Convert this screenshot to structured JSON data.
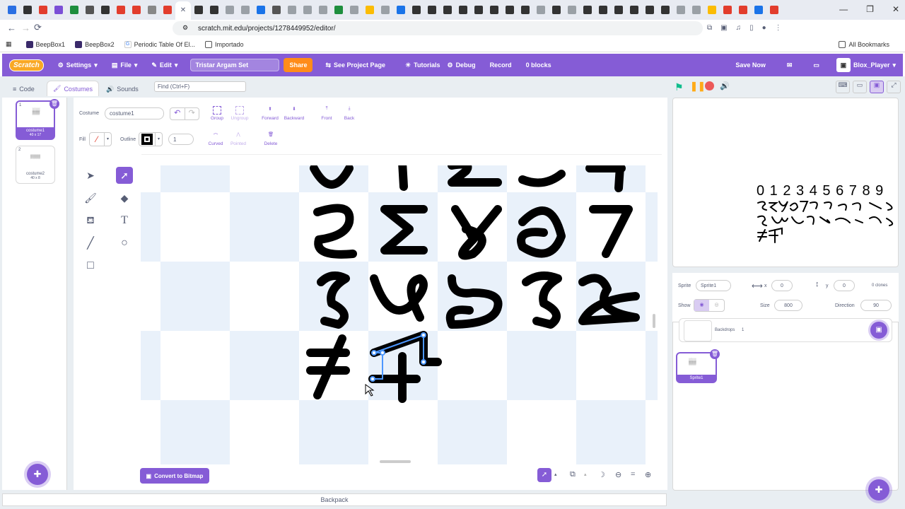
{
  "browser": {
    "url": "scratch.mit.edu/projects/1278449952/editor/",
    "bookmarks": [
      "BeepBox1",
      "BeepBox2",
      "Periodic Table Of El...",
      "Importado"
    ],
    "all_bookmarks_label": "All Bookmarks",
    "tab_colors": [
      "#2b6fe3",
      "#333",
      "#e23d2d",
      "#7b4fd6",
      "#1e8e3e",
      "#555",
      "#333",
      "#e23d2d",
      "#e23d2d",
      "#888",
      "#e23d2d",
      "#fff",
      "#333",
      "#333",
      "#9aa0a6",
      "#9aa0a6",
      "#1a73e8",
      "#555",
      "#9aa0a6",
      "#9aa0a6",
      "#9aa0a6",
      "#1e8e3e",
      "#9aa0a6",
      "#fbbc04",
      "#9aa0a6",
      "#1a73e8",
      "#333",
      "#333",
      "#333",
      "#333",
      "#333",
      "#333",
      "#333",
      "#333",
      "#9aa0a6",
      "#333",
      "#9aa0a6",
      "#333",
      "#333",
      "#333",
      "#333",
      "#333",
      "#333",
      "#9aa0a6",
      "#9aa0a6",
      "#fbbc04",
      "#e23d2d",
      "#e23d2d",
      "#1a73e8",
      "#e23d2d"
    ]
  },
  "menubar": {
    "logo": "Scratch",
    "settings": "Settings",
    "file": "File",
    "edit": "Edit",
    "project_title": "Tristar Argam Set",
    "share": "Share",
    "see_project_page": "See Project Page",
    "tutorials": "Tutorials",
    "debug": "Debug",
    "record": "Record",
    "blocks": "0 blocks",
    "save_now": "Save Now",
    "username": "Blox_Player"
  },
  "editor_tabs": {
    "code": "Code",
    "costumes": "Costumes",
    "sounds": "Sounds",
    "find_placeholder": "Find (Ctrl+F)"
  },
  "costumes": [
    {
      "num": "1",
      "name": "costume1",
      "size": "40 x 17"
    },
    {
      "num": "2",
      "name": "costume2",
      "size": "40 x 8"
    }
  ],
  "paint": {
    "costume_label": "Costume",
    "costume_name": "costume1",
    "fill_label": "Fill",
    "outline_label": "Outline",
    "outline_width": "1",
    "group": "Group",
    "ungroup": "Ungroup",
    "forward": "Forward",
    "backward": "Backward",
    "front": "Front",
    "back": "Back",
    "curved": "Curved",
    "pointed": "Pointed",
    "delete": "Delete",
    "convert": "Convert to Bitmap",
    "primary_color": "#855cd6"
  },
  "sprite_info": {
    "sprite_label": "Sprite",
    "sprite_name": "Sprite1",
    "x_label": "x",
    "x_value": "0",
    "y_label": "y",
    "y_value": "0",
    "clones": "0 clones",
    "show_label": "Show",
    "size_label": "Size",
    "size_value": "800",
    "direction_label": "Direction",
    "direction_value": "90",
    "backdrops_label": "Backdrops",
    "backdrops_count": "1"
  },
  "sprites": [
    {
      "name": "Sprite1"
    }
  ],
  "backpack": "Backpack",
  "stage_text": {
    "row1": "0 1 2 3 4 5 6 7 8 9"
  }
}
